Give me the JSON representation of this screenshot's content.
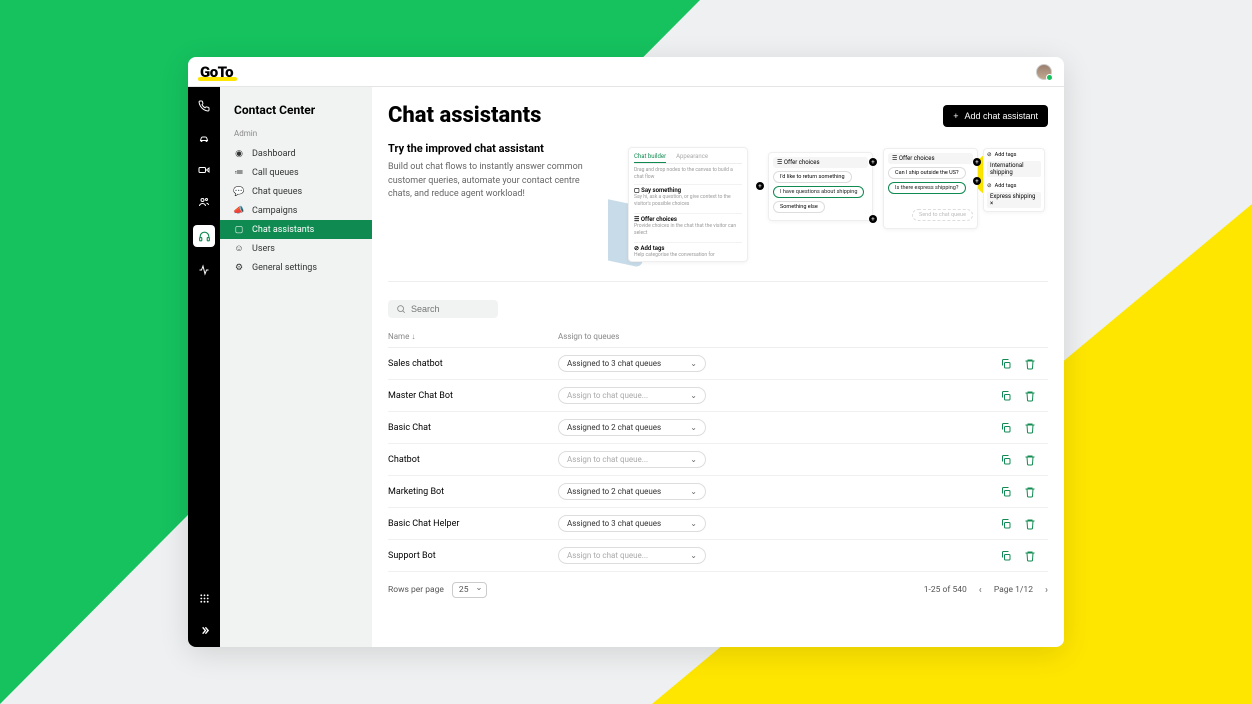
{
  "header": {
    "logo": "GoTo"
  },
  "mini_sidebar": {
    "items": [
      {
        "name": "phone-icon"
      },
      {
        "name": "car-icon"
      },
      {
        "name": "video-icon"
      },
      {
        "name": "people-icon"
      },
      {
        "name": "headset-icon",
        "active": true
      },
      {
        "name": "activity-icon"
      }
    ],
    "bottom": [
      {
        "name": "grid-icon"
      },
      {
        "name": "expand-icon"
      }
    ]
  },
  "sidebar": {
    "title": "Contact Center",
    "section": "Admin",
    "items": [
      {
        "label": "Dashboard",
        "icon": "gauge-icon"
      },
      {
        "label": "Call queues",
        "icon": "list-icon"
      },
      {
        "label": "Chat queues",
        "icon": "chat-lines-icon"
      },
      {
        "label": "Campaigns",
        "icon": "megaphone-icon"
      },
      {
        "label": "Chat assistants",
        "icon": "chat-bubble-icon",
        "active": true
      },
      {
        "label": "Users",
        "icon": "user-icon"
      },
      {
        "label": "General settings",
        "icon": "gear-icon"
      }
    ]
  },
  "page": {
    "title": "Chat assistants",
    "add_button": "Add chat assistant",
    "promo_title": "Try the improved chat assistant",
    "promo_desc": "Build out chat flows to instantly answer common customer queries, automate your contact centre chats, and reduce agent workload!"
  },
  "promo_image": {
    "tab1": "Chat builder",
    "tab2": "Appearance",
    "hint": "Drag and drop nodes to the canvas to build a chat flow",
    "b1_title": "Say something",
    "b1_desc": "Say hi, ask a question, or give context to the visitor's possible choices",
    "b2_title": "Offer choices",
    "b2_desc": "Provide choices in the chat that the visitor can select",
    "b3_title": "Add tags",
    "b3_desc": "Help categorise the conversation for",
    "p2_title": "Offer choices",
    "p2_a": "I'd like to return something",
    "p2_b": "I have questions about shipping",
    "p2_c": "Something else",
    "p3_title": "Offer choices",
    "p3_a": "Can I ship outside the US?",
    "p3_b": "Is there express shipping?",
    "p3_c": "Send to chat queue",
    "p4_t1": "Add tags",
    "p4_v1": "International shipping",
    "p4_t2": "Add tags",
    "p4_v2": "Express shipping"
  },
  "search": {
    "placeholder": "Search"
  },
  "table": {
    "columns": {
      "name": "Name",
      "queue": "Assign to queues"
    },
    "sort_icon": "↓",
    "placeholder_queue": "Assign to chat queue...",
    "rows": [
      {
        "name": "Sales chatbot",
        "queue": "Assigned to 3 chat queues"
      },
      {
        "name": "Master Chat Bot",
        "queue": ""
      },
      {
        "name": "Basic Chat",
        "queue": "Assigned to 2 chat queues"
      },
      {
        "name": "Chatbot",
        "queue": ""
      },
      {
        "name": "Marketing Bot",
        "queue": "Assigned to 2 chat queues"
      },
      {
        "name": "Basic Chat Helper",
        "queue": "Assigned to 3 chat queues"
      },
      {
        "name": "Support Bot",
        "queue": ""
      }
    ]
  },
  "pagination": {
    "rows_label": "Rows per page",
    "rows_value": "25",
    "range": "1-25 of 540",
    "page": "Page 1/12"
  }
}
